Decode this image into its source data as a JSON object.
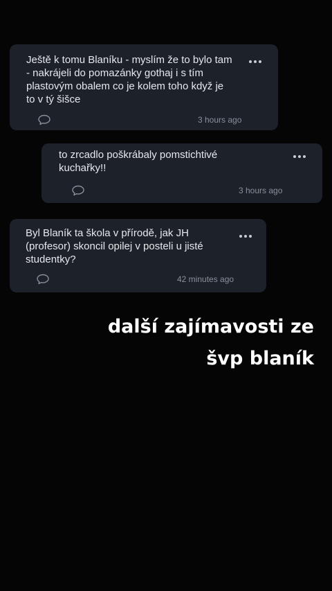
{
  "comments": [
    {
      "text": "Ještě k tomu Blaníku - myslím že to bylo tam\n- nakrájeli do pomazánky gothaj i s tím\nplastovým obalem co je kolem toho když je\nto v tý šišce",
      "timestamp": "3 hours ago",
      "reply_icon": "comment-bubble-icon",
      "menu_icon": "more-dots-icon"
    },
    {
      "text": "to zrcadlo poškrábaly pomstichtivé\nkuchařky!!",
      "timestamp": "3 hours ago",
      "reply_icon": "comment-bubble-icon",
      "menu_icon": "more-dots-icon"
    },
    {
      "text": "Byl Blaník ta škola v přírodě, jak JH\n(profesor) skoncil opilej v posteli u jisté\nstudentky?",
      "timestamp": "42 minutes ago",
      "reply_icon": "comment-bubble-icon",
      "menu_icon": "more-dots-icon"
    }
  ],
  "overlay": {
    "line1": "další zajímavosti ze",
    "line2": "švp blaník"
  },
  "colors": {
    "background": "#050505",
    "card": "#1c212a",
    "text": "#e6e8ec",
    "muted": "#8a8f98"
  }
}
